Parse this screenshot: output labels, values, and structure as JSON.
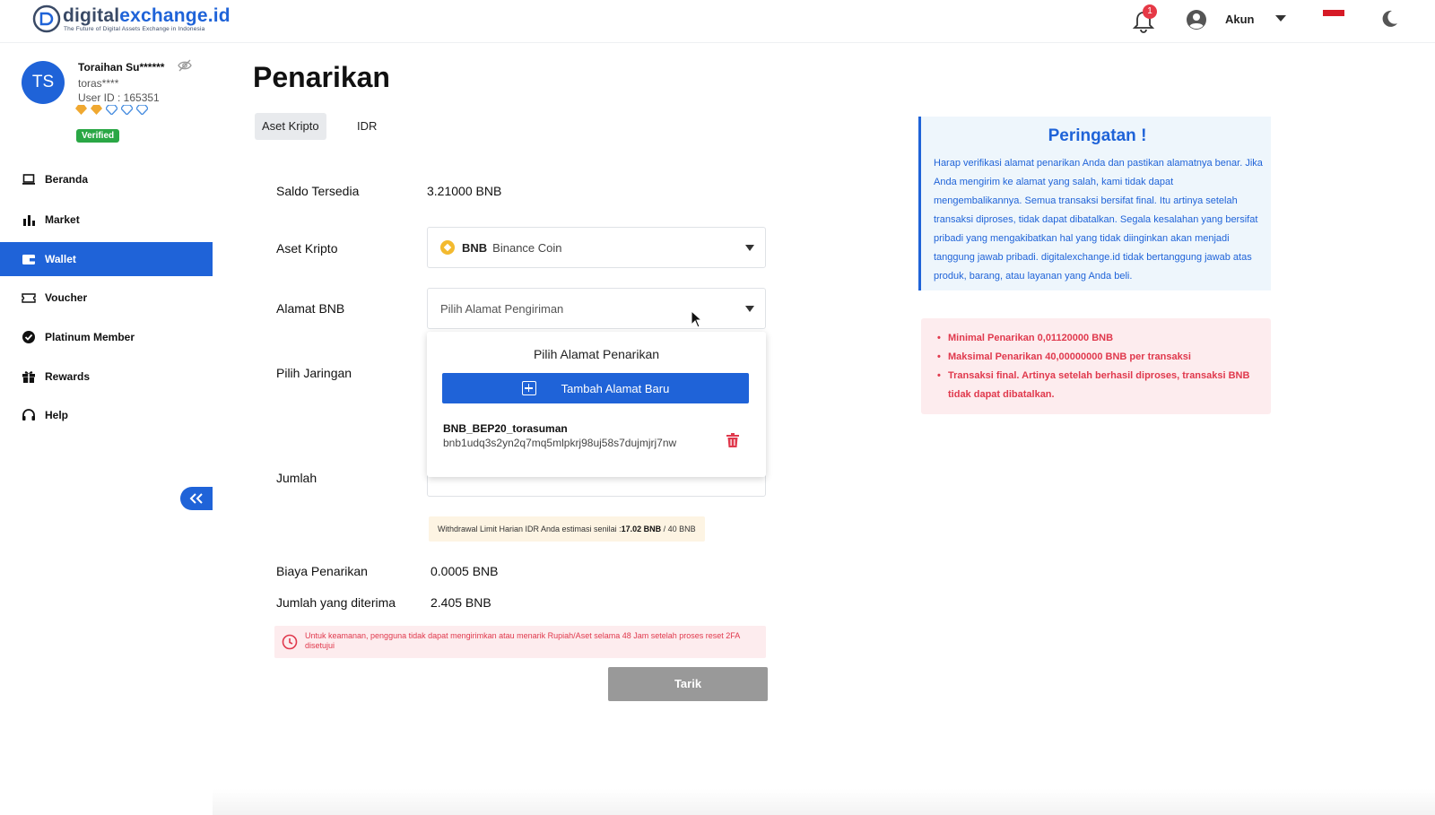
{
  "header": {
    "logo_name_prefix": "digital",
    "logo_name_suffix": "exchange.id",
    "logo_tagline": "The Future of Digital Assets Exchange in Indonesia",
    "notification_count": "1",
    "account_label": "Akun"
  },
  "user": {
    "initials": "TS",
    "name": "Toraihan Su******",
    "handle": "toras****",
    "user_id": "User ID : 165351",
    "verified_label": "Verified"
  },
  "sidebar": {
    "items": [
      {
        "label": "Beranda",
        "icon": "laptop-icon"
      },
      {
        "label": "Market",
        "icon": "bar-chart-icon"
      },
      {
        "label": "Wallet",
        "icon": "wallet-icon"
      },
      {
        "label": "Voucher",
        "icon": "ticket-icon"
      },
      {
        "label": "Platinum Member",
        "icon": "badge-check-icon"
      },
      {
        "label": "Rewards",
        "icon": "gift-icon"
      },
      {
        "label": "Help",
        "icon": "headset-icon"
      }
    ],
    "active": "Wallet"
  },
  "main": {
    "title": "Penarikan",
    "tabs": [
      {
        "label": "Aset Kripto"
      },
      {
        "label": "IDR"
      }
    ],
    "saldo_label": "Saldo Tersedia",
    "saldo_value": "3.21000 BNB",
    "asset_label": "Aset Kripto",
    "asset_symbol": "BNB",
    "asset_name": "Binance Coin",
    "address_label": "Alamat BNB",
    "address_placeholder": "Pilih Alamat Pengiriman",
    "network_label": "Pilih Jaringan",
    "amount_label": "Jumlah",
    "limit_note_prefix": "Withdrawal Limit Harian IDR Anda estimasi senilai  :",
    "limit_note_value": "17.02 BNB",
    "limit_note_suffix": " / 40 BNB",
    "fee_label": "Biaya Penarikan",
    "fee_value": "0.0005 BNB",
    "received_label": "Jumlah yang diterima",
    "received_value": "2.405 BNB",
    "security_alert": "Untuk keamanan, pengguna tidak dapat mengirimkan atau menarik Rupiah/Aset selama 48 Jam setelah proses reset 2FA disetujui",
    "submit_label": "Tarik"
  },
  "dropdown": {
    "title": "Pilih Alamat Penarikan",
    "add_label": "Tambah Alamat Baru",
    "addresses": [
      {
        "name": "BNB_BEP20_torasuman",
        "address": "bnb1udq3s2yn2q7mq5mlpkrj98uj58s7dujmjrj7nw"
      }
    ]
  },
  "warning": {
    "title": "Peringatan !",
    "text": "Harap verifikasi alamat penarikan Anda dan pastikan alamatnya benar. Jika Anda mengirim ke alamat yang salah, kami tidak dapat mengembalikannya. Semua transaksi bersifat final. Itu artinya setelah transaksi diproses, tidak dapat dibatalkan. Segala kesalahan yang bersifat pribadi yang mengakibatkan hal yang tidak diinginkan akan menjadi tanggung jawab pribadi. digitalexchange.id tidak bertanggung jawab atas produk, barang, atau layanan yang Anda beli."
  },
  "limits": [
    "Minimal Penarikan 0,01120000 BNB",
    "Maksimal Penarikan 40,00000000 BNB per transaksi",
    "Transaksi final. Artinya setelah berhasil diproses, transaksi BNB tidak dapat dibatalkan."
  ],
  "colors": {
    "primary": "#1f63d8",
    "danger": "#e0394d",
    "success": "#2aa745",
    "warning_bg": "#eef6fc",
    "danger_bg": "#fdecee"
  }
}
